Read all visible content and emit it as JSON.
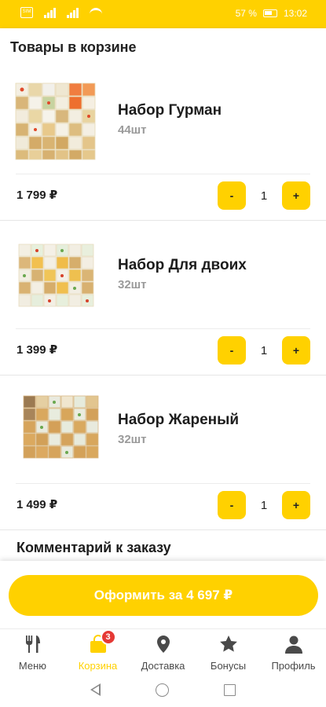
{
  "status_bar": {
    "battery_percent": "57 %",
    "time": "13:02",
    "sim_label": "SIM"
  },
  "header": {
    "title": "Товары в корзине"
  },
  "cart_items": [
    {
      "name": "Набор Гурман",
      "count": "44шт",
      "price": "1 799 ₽",
      "quantity": "1",
      "minus_label": "-",
      "plus_label": "+",
      "image_icon": "sushi-set-gourmet"
    },
    {
      "name": "Набор Для двоих",
      "count": "32шт",
      "price": "1 399 ₽",
      "quantity": "1",
      "minus_label": "-",
      "plus_label": "+",
      "image_icon": "sushi-set-for-two"
    },
    {
      "name": "Набор Жареный",
      "count": "32шт",
      "price": "1 499 ₽",
      "quantity": "1",
      "minus_label": "-",
      "plus_label": "+",
      "image_icon": "sushi-set-fried"
    }
  ],
  "comment": {
    "title": "Комментарий к заказу"
  },
  "checkout": {
    "label": "Оформить за 4 697 ₽"
  },
  "tabs": [
    {
      "label": "Меню",
      "icon": "fork-knife-icon"
    },
    {
      "label": "Корзина",
      "icon": "bag-icon",
      "badge": "3",
      "active": true
    },
    {
      "label": "Доставка",
      "icon": "map-pin-icon"
    },
    {
      "label": "Бонусы",
      "icon": "star-icon"
    },
    {
      "label": "Профиль",
      "icon": "person-icon"
    }
  ],
  "colors": {
    "accent": "#ffd100",
    "badge": "#e53935",
    "text": "#222222",
    "muted": "#9a9a9a"
  }
}
